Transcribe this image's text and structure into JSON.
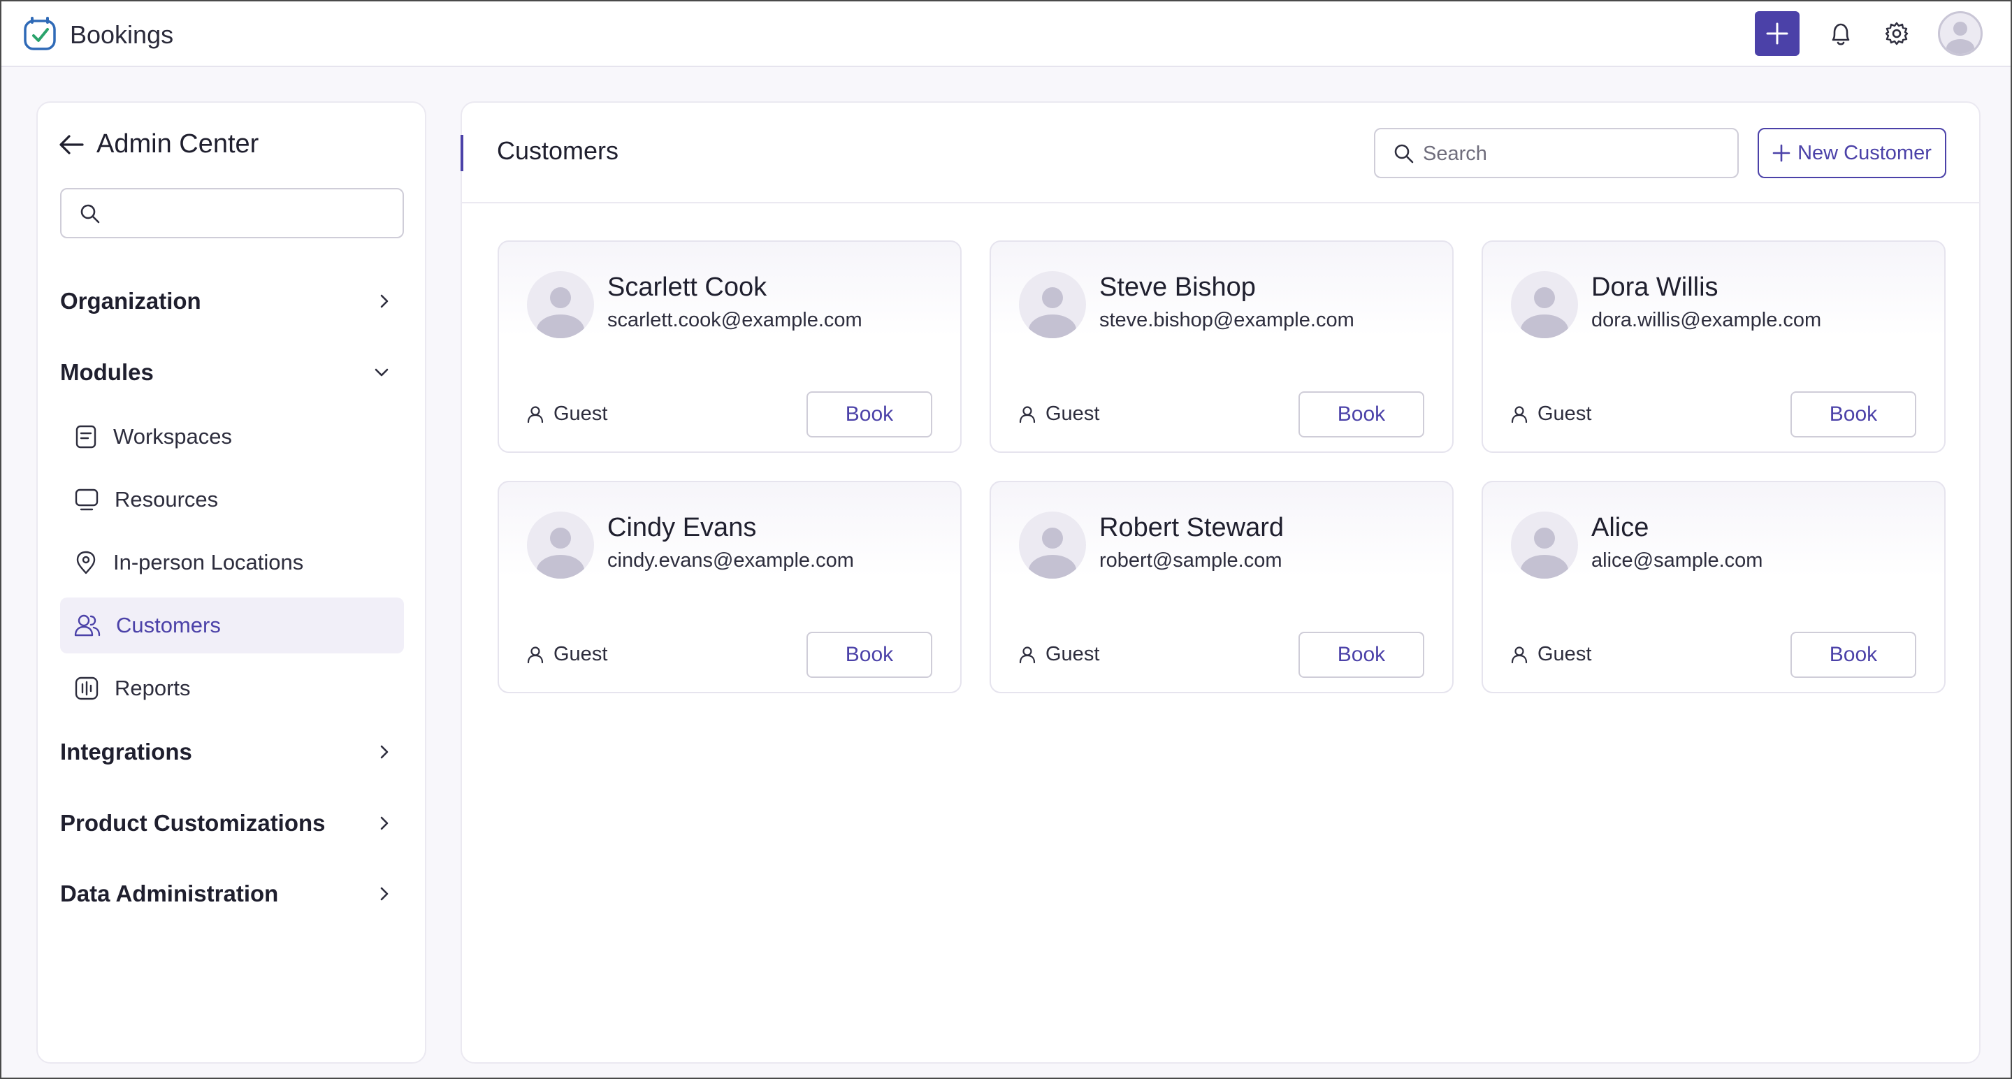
{
  "app": {
    "title": "Bookings"
  },
  "sidebar": {
    "title": "Admin Center",
    "search_placeholder": "",
    "sections": {
      "organization": "Organization",
      "modules": "Modules",
      "integrations": "Integrations",
      "product_customizations": "Product Customizations",
      "data_administration": "Data Administration"
    },
    "modules": [
      {
        "label": "Workspaces",
        "icon": "document-icon"
      },
      {
        "label": "Resources",
        "icon": "monitor-icon"
      },
      {
        "label": "In-person Locations",
        "icon": "location-pin-icon"
      },
      {
        "label": "Customers",
        "icon": "users-icon",
        "active": true
      },
      {
        "label": "Reports",
        "icon": "report-icon"
      }
    ]
  },
  "main": {
    "title": "Customers",
    "search_placeholder": "Search",
    "new_button": "New Customer",
    "customers": [
      {
        "name": "Scarlett Cook",
        "email": "scarlett.cook@example.com",
        "role": "Guest",
        "action": "Book"
      },
      {
        "name": "Steve Bishop",
        "email": "steve.bishop@example.com",
        "role": "Guest",
        "action": "Book"
      },
      {
        "name": "Dora Willis",
        "email": "dora.willis@example.com",
        "role": "Guest",
        "action": "Book"
      },
      {
        "name": "Cindy Evans",
        "email": "cindy.evans@example.com",
        "role": "Guest",
        "action": "Book"
      },
      {
        "name": "Robert Steward",
        "email": "robert@sample.com",
        "role": "Guest",
        "action": "Book"
      },
      {
        "name": "Alice",
        "email": "alice@sample.com",
        "role": "Guest",
        "action": "Book"
      }
    ]
  },
  "colors": {
    "accent": "#4b41a8",
    "border": "#e6e4ee",
    "background": "#f8f7fb"
  }
}
